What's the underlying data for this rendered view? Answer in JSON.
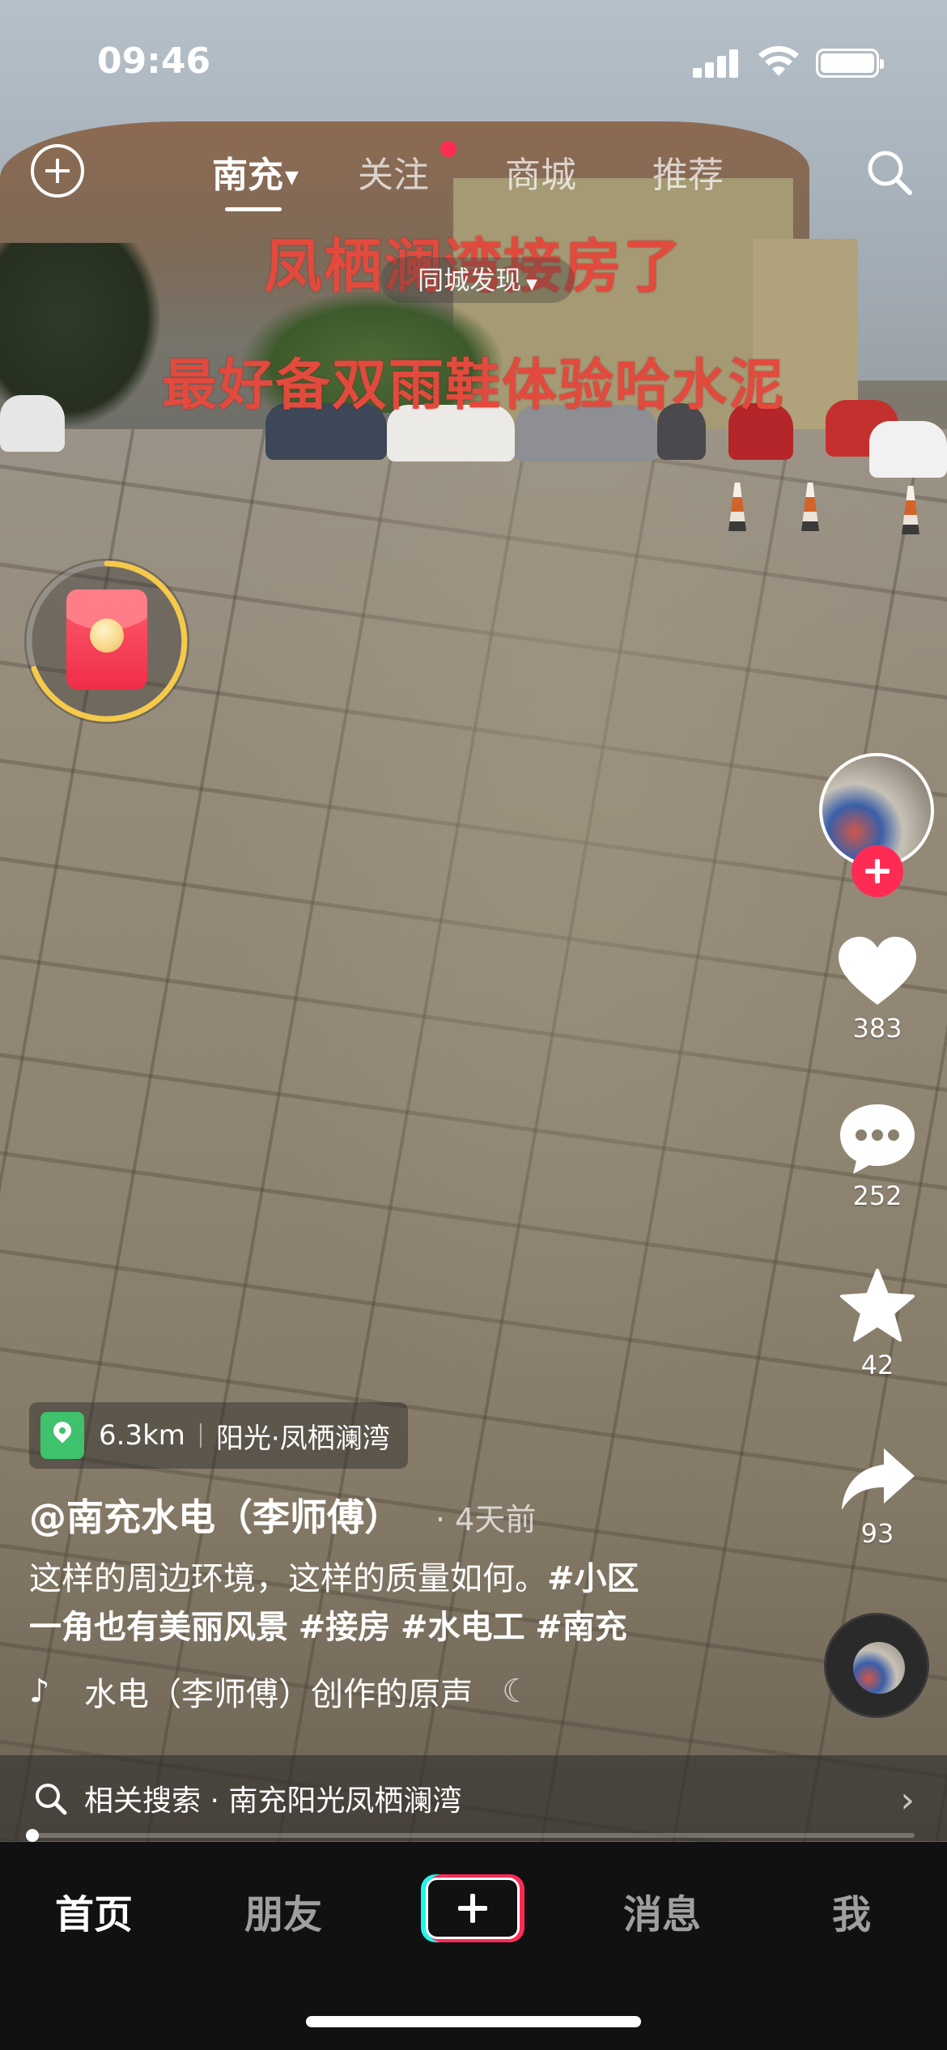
{
  "status_bar": {
    "time": "09:46"
  },
  "top_nav": {
    "city_tab": "南充",
    "tabs": [
      "关注",
      "商城",
      "推荐"
    ],
    "sub_nav": "同城发现"
  },
  "video_overlay": {
    "line1": "凤栖澜湾接房了",
    "line2": "最好备双雨鞋体验哈水泥"
  },
  "actions": {
    "likes": "383",
    "comments": "252",
    "favorites": "42",
    "shares": "93"
  },
  "location": {
    "distance": "6.3km",
    "place": "阳光·凤栖澜湾"
  },
  "author": {
    "name": "@南充水电（李师傅）",
    "posted": "· 4天前"
  },
  "description": {
    "text": "这样的周边环境，这样的质量如何。",
    "tags": [
      "#小区",
      "一角也有美丽风景",
      "#接房",
      "#水电工",
      "#南充"
    ]
  },
  "music": {
    "title": "水电（李师傅）创作的原声"
  },
  "related_search": {
    "label": "相关搜索 · 南充阳光凤栖澜湾"
  },
  "playback": {
    "progress": 0.0
  },
  "tab_bar": {
    "home": "首页",
    "friends": "朋友",
    "messages": "消息",
    "me": "我"
  },
  "colors": {
    "accent": "#fe2c55",
    "cyan": "#25f4ee",
    "location_green": "#3ec26c"
  },
  "icons": [
    "plus-circle-icon",
    "search-icon",
    "red-packet-icon",
    "heart-icon",
    "comment-icon",
    "star-icon",
    "share-icon",
    "music-note-icon",
    "location-pin-icon",
    "chevron-right-icon"
  ]
}
